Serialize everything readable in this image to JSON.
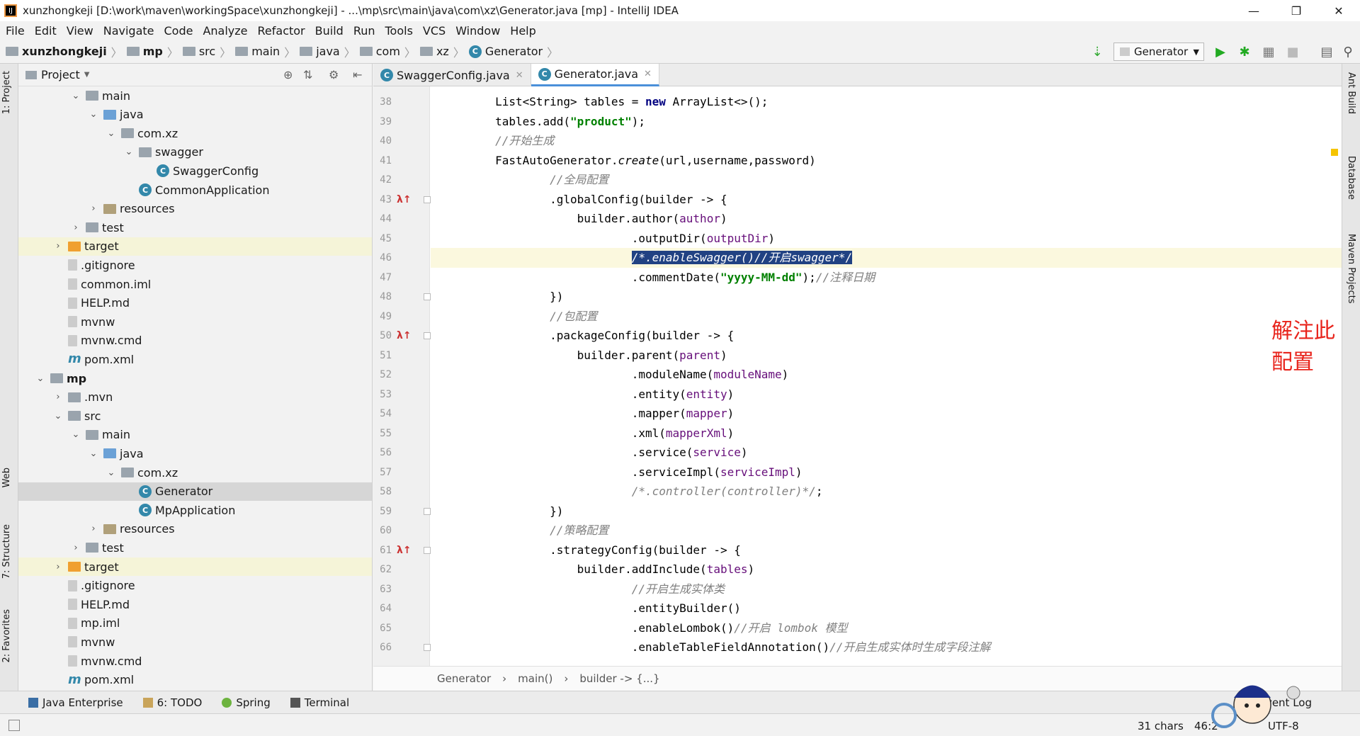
{
  "window": {
    "title": "xunzhongkeji [D:\\work\\maven\\workingSpace\\xunzhongkeji] - ...\\mp\\src\\main\\java\\com\\xz\\Generator.java [mp] - IntelliJ IDEA",
    "app_icon": "IJ",
    "minimize": "—",
    "restore": "❐",
    "close": "✕"
  },
  "menu": [
    "File",
    "Edit",
    "View",
    "Navigate",
    "Code",
    "Analyze",
    "Refactor",
    "Build",
    "Run",
    "Tools",
    "VCS",
    "Window",
    "Help"
  ],
  "breadcrumbs": [
    "xunzhongkeji",
    "mp",
    "src",
    "main",
    "java",
    "com",
    "xz",
    "Generator"
  ],
  "run_config": "Generator",
  "project_panel": {
    "title": "Project",
    "tree": [
      {
        "label": "main",
        "level": 3,
        "arrow": "v",
        "icon": "dir"
      },
      {
        "label": "java",
        "level": 4,
        "arrow": "v",
        "icon": "src"
      },
      {
        "label": "com.xz",
        "level": 5,
        "arrow": "v",
        "icon": "dir"
      },
      {
        "label": "swagger",
        "level": 6,
        "arrow": "v",
        "icon": "dir"
      },
      {
        "label": "SwaggerConfig",
        "level": 7,
        "arrow": "",
        "icon": "class"
      },
      {
        "label": "CommonApplication",
        "level": 6,
        "arrow": "",
        "icon": "class"
      },
      {
        "label": "resources",
        "level": 4,
        "arrow": ">",
        "icon": "res"
      },
      {
        "label": "test",
        "level": 3,
        "arrow": ">",
        "icon": "dir"
      },
      {
        "label": "target",
        "level": 2,
        "arrow": ">",
        "icon": "tgt",
        "highlight": true
      },
      {
        "label": ".gitignore",
        "level": 2,
        "arrow": "",
        "icon": "file"
      },
      {
        "label": "common.iml",
        "level": 2,
        "arrow": "",
        "icon": "file"
      },
      {
        "label": "HELP.md",
        "level": 2,
        "arrow": "",
        "icon": "file"
      },
      {
        "label": "mvnw",
        "level": 2,
        "arrow": "",
        "icon": "file"
      },
      {
        "label": "mvnw.cmd",
        "level": 2,
        "arrow": "",
        "icon": "file"
      },
      {
        "label": "pom.xml",
        "level": 2,
        "arrow": "",
        "icon": "m"
      },
      {
        "label": "mp",
        "level": 1,
        "arrow": "v",
        "icon": "dir",
        "bold": true
      },
      {
        "label": ".mvn",
        "level": 2,
        "arrow": ">",
        "icon": "dir"
      },
      {
        "label": "src",
        "level": 2,
        "arrow": "v",
        "icon": "dir"
      },
      {
        "label": "main",
        "level": 3,
        "arrow": "v",
        "icon": "dir"
      },
      {
        "label": "java",
        "level": 4,
        "arrow": "v",
        "icon": "src"
      },
      {
        "label": "com.xz",
        "level": 5,
        "arrow": "v",
        "icon": "dir"
      },
      {
        "label": "Generator",
        "level": 6,
        "arrow": "",
        "icon": "class",
        "selected": true
      },
      {
        "label": "MpApplication",
        "level": 6,
        "arrow": "",
        "icon": "class"
      },
      {
        "label": "resources",
        "level": 4,
        "arrow": ">",
        "icon": "res"
      },
      {
        "label": "test",
        "level": 3,
        "arrow": ">",
        "icon": "dir"
      },
      {
        "label": "target",
        "level": 2,
        "arrow": ">",
        "icon": "tgt",
        "highlight": true
      },
      {
        "label": ".gitignore",
        "level": 2,
        "arrow": "",
        "icon": "file"
      },
      {
        "label": "HELP.md",
        "level": 2,
        "arrow": "",
        "icon": "file"
      },
      {
        "label": "mp.iml",
        "level": 2,
        "arrow": "",
        "icon": "file"
      },
      {
        "label": "mvnw",
        "level": 2,
        "arrow": "",
        "icon": "file"
      },
      {
        "label": "mvnw.cmd",
        "level": 2,
        "arrow": "",
        "icon": "file"
      },
      {
        "label": "pom.xml",
        "level": 2,
        "arrow": "",
        "icon": "m"
      }
    ]
  },
  "editor_tabs": [
    {
      "label": "SwaggerConfig.java",
      "active": false
    },
    {
      "label": "Generator.java",
      "active": true
    }
  ],
  "code_lines": [
    {
      "n": "38",
      "html": "        List&lt;String&gt; tables = <span class=\"kw\">new</span> ArrayList&lt;&gt;();"
    },
    {
      "n": "39",
      "html": "        tables.add(<span class=\"str\">\"product\"</span>);"
    },
    {
      "n": "40",
      "html": "        <span class=\"cm\">//开始生成</span>"
    },
    {
      "n": "41",
      "html": "        FastAutoGenerator.<span class=\"it\">create</span>(url,username,password)"
    },
    {
      "n": "42",
      "html": "                <span class=\"cm\">//全局配置</span>"
    },
    {
      "n": "43",
      "html": "                .globalConfig(builder -&gt; {",
      "mark": "λ↑"
    },
    {
      "n": "44",
      "html": "                    builder.author(<span class=\"var\">author</span>)"
    },
    {
      "n": "45",
      "html": "                            .outputDir(<span class=\"var\">outputDir</span>)"
    },
    {
      "n": "46",
      "html": "                            <span class=\"sel-text\">/*.enableSwagger()//开启swagger*/</span>",
      "current": true,
      "bulb": true
    },
    {
      "n": "47",
      "html": "                            .commentDate(<span class=\"str\">\"yyyy-MM-dd\"</span>);<span class=\"cm\">//注释日期</span>"
    },
    {
      "n": "48",
      "html": "                })"
    },
    {
      "n": "49",
      "html": "                <span class=\"cm\">//包配置</span>"
    },
    {
      "n": "50",
      "html": "                .packageConfig(builder -&gt; {",
      "mark": "λ↑"
    },
    {
      "n": "51",
      "html": "                    builder.parent(<span class=\"var\">parent</span>)"
    },
    {
      "n": "52",
      "html": "                            .moduleName(<span class=\"var\">moduleName</span>)"
    },
    {
      "n": "53",
      "html": "                            .entity(<span class=\"var\">entity</span>)"
    },
    {
      "n": "54",
      "html": "                            .mapper(<span class=\"var\">mapper</span>)"
    },
    {
      "n": "55",
      "html": "                            .xml(<span class=\"var\">mapperXml</span>)"
    },
    {
      "n": "56",
      "html": "                            .service(<span class=\"var\">service</span>)"
    },
    {
      "n": "57",
      "html": "                            .serviceImpl(<span class=\"var\">serviceImpl</span>)"
    },
    {
      "n": "58",
      "html": "                            <span class=\"cm\">/*.controller(controller)*/</span>;"
    },
    {
      "n": "59",
      "html": "                })"
    },
    {
      "n": "60",
      "html": "                <span class=\"cm\">//策略配置</span>"
    },
    {
      "n": "61",
      "html": "                .strategyConfig(builder -&gt; {",
      "mark": "λ↑"
    },
    {
      "n": "62",
      "html": "                    builder.addInclude(<span class=\"var\">tables</span>)"
    },
    {
      "n": "63",
      "html": "                            <span class=\"cm\">//开启生成实体类</span>"
    },
    {
      "n": "64",
      "html": "                            .entityBuilder()"
    },
    {
      "n": "65",
      "html": "                            .enableLombok()<span class=\"cm\">//开启 lombok 模型</span>"
    },
    {
      "n": "66",
      "html": "                            .enableTableFieldAnnotation()<span class=\"cm\">//开启生成实体时生成字段注解</span>"
    }
  ],
  "annotation": "解注此配置",
  "editor_breadcrumb": [
    "Generator",
    "main()",
    "builder -> {...}"
  ],
  "left_tool_windows": [
    "1: Project",
    "Web",
    "7: Structure",
    "2: Favorites"
  ],
  "right_tool_windows": [
    "Ant Build",
    "Database",
    "Maven Projects"
  ],
  "bottom_tabs": [
    "Java Enterprise",
    "6: TODO",
    "Spring",
    "Terminal"
  ],
  "status": {
    "chars": "31 chars",
    "position": "46:2",
    "event_log": "Event Log",
    "encoding": "UTF-8"
  },
  "colors": {
    "accent": "#4a90d9",
    "annotation": "#e8231b",
    "selection": "#214283"
  }
}
